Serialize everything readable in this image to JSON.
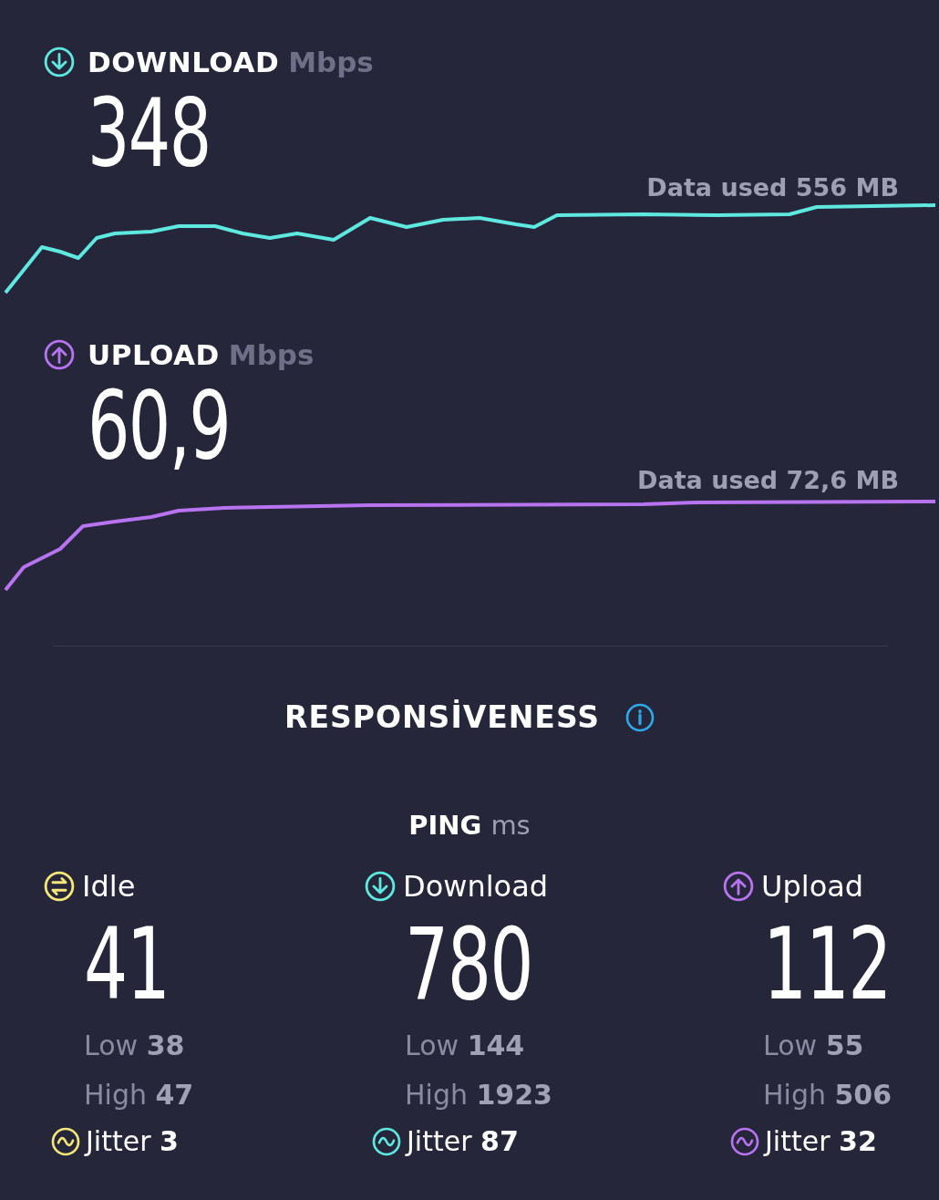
{
  "speeds": [
    {
      "kind": "download",
      "color": "#5ee8e0",
      "title": "DOWNLOAD",
      "unit": "Mbps",
      "value": "348",
      "data_used": "Data used 556 MB"
    },
    {
      "kind": "upload",
      "color": "#b873f0",
      "title": "UPLOAD",
      "unit": "Mbps",
      "value": "60,9",
      "data_used": "Data used 72,6 MB"
    }
  ],
  "responsiveness": {
    "title": "RESPONSİVENESS",
    "ping": {
      "title": "PING",
      "unit": "ms"
    },
    "columns": [
      {
        "kind": "idle",
        "color": "#f5e67a",
        "label": "Idle",
        "value": "41",
        "low": "Low **38**",
        "high": "High **47**",
        "jitter": "Jitter **3**"
      },
      {
        "kind": "download",
        "color": "#5ee8e0",
        "label": "Download",
        "value": "780",
        "low": "Low **144**",
        "high": "High **1923**",
        "jitter": "Jitter **87**"
      },
      {
        "kind": "upload",
        "color": "#b873f0",
        "label": "Upload",
        "value": "112",
        "low": "Low **55**",
        "high": "High **506**",
        "jitter": "Jitter **32**"
      }
    ]
  }
}
